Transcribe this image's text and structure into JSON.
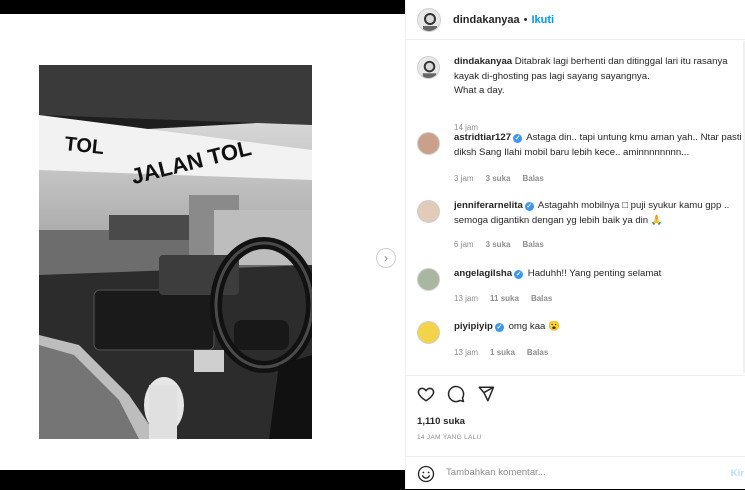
{
  "post": {
    "author": "dindakanyaa",
    "follow_label": "Ikuti",
    "dot": "•",
    "caption_line1": "Ditabrak lagi berhenti dan ditinggal lari itu rasanya",
    "caption_line2": "kayak di-ghosting pas lagi sayang sayangnya.",
    "caption_line3": "What a day.",
    "caption_time": "14 jam"
  },
  "comments": [
    {
      "user": "astridtiar127",
      "verified": true,
      "text": "Astaga din.. tapi untung kmu aman yah.. Ntar pasti diksh Sang Ilahi mobil baru lebih kece.. aminnnnnnnn...",
      "time": "3 jam",
      "likes": "3 suka",
      "reply": "Balas"
    },
    {
      "user": "jenniferarnelita",
      "verified": true,
      "text": "Astagahh mobilnya □ puji syukur kamu gpp .. semoga digantikn dengan yg lebih baik ya din 🙏",
      "time": "6 jam",
      "likes": "3 suka",
      "reply": "Balas"
    },
    {
      "user": "angelagilsha",
      "verified": true,
      "text": "Haduhh!! Yang penting selamat",
      "time": "13 jam",
      "likes": "11 suka",
      "reply": "Balas"
    },
    {
      "user": "piyipiyip",
      "verified": true,
      "text": "omg kaa 😮",
      "time": "13 jam",
      "likes": "1 suka",
      "reply": "Balas"
    }
  ],
  "actions": {
    "like_count": "1,110 suka",
    "time_ago": "14 JAM YANG LALU"
  },
  "composer": {
    "placeholder": "Tambahkan komentar...",
    "post_label": "Kir"
  },
  "icons": {
    "like": "heart-icon",
    "comment": "comment-icon",
    "share": "paper-plane-icon",
    "emoji": "smiley-icon",
    "next": "chevron-right-icon"
  },
  "colors": {
    "accent": "#0095f6",
    "verified": "#3897f0",
    "muted": "#8e8e8e",
    "text": "#262626"
  }
}
